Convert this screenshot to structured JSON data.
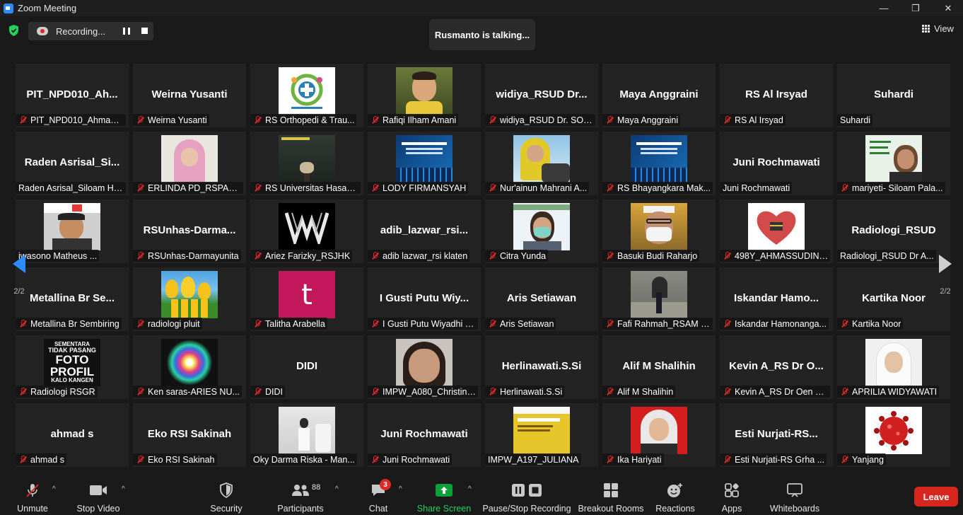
{
  "window": {
    "title": "Zoom Meeting",
    "minimize": "—",
    "restore": "❐",
    "close": "✕"
  },
  "recording": {
    "label": "Recording..."
  },
  "speaker_banner": "Rusmanto is talking...",
  "view_label": "View",
  "pager": {
    "prev": "2/2",
    "next": "2/2"
  },
  "tiles": [
    {
      "big": "PIT_NPD010_Ah...",
      "name": "PIT_NPD010_Ahmad ...",
      "muted": true
    },
    {
      "big": "Weirna Yusanti",
      "name": "Weirna Yusanti",
      "muted": true
    },
    {
      "photo": "ortho-logo",
      "name": "RS Orthopedi & Trau...",
      "muted": true
    },
    {
      "photo": "boy-photo",
      "name": "Rafiqi Ilham Amani",
      "muted": true
    },
    {
      "big": "widiya_RSUD Dr...",
      "name": "widiya_RSUD Dr. SOE...",
      "muted": true
    },
    {
      "big": "Maya Anggraini",
      "name": "Maya Anggraini",
      "muted": true
    },
    {
      "big": "RS Al Irsyad",
      "name": "RS Al Irsyad",
      "muted": true
    },
    {
      "big": "Suhardi",
      "name": "Suhardi",
      "muted": false
    },
    {
      "big": "Raden Asrisal_Si...",
      "name": "Raden Asrisal_Siloam Ho...",
      "muted": false
    },
    {
      "photo": "hijab-girl",
      "name": "ERLINDA PD_RSPAU ...",
      "muted": true
    },
    {
      "photo": "room-plant",
      "name": "RS Universitas Hasan...",
      "muted": true
    },
    {
      "photo": "webinar-blue",
      "name": "LODY FIRMANSYAH",
      "muted": true
    },
    {
      "photo": "hijab-yellow",
      "name": "Nur'ainun Mahrani A...",
      "muted": true
    },
    {
      "photo": "webinar-blue",
      "name": "RS Bhayangkara Mak...",
      "muted": true
    },
    {
      "big": "Juni Rochmawati",
      "name": "Juni Rochmawati",
      "muted": false
    },
    {
      "photo": "woman-slide",
      "name": "mariyeti- Siloam Pala...",
      "muted": true
    },
    {
      "photo": "man-banner",
      "name": "iwasono Matheus ...",
      "muted": false
    },
    {
      "big": "RSUnhas-Darma...",
      "name": "RSUnhas-Darmayunita",
      "muted": true
    },
    {
      "photo": "ww-logo",
      "name": "Ariez Farizky_RSJHK",
      "muted": true
    },
    {
      "big": "adib_lazwar_rsi...",
      "name": "adib lazwar_rsi klaten",
      "muted": true
    },
    {
      "photo": "mask-person",
      "name": "Citra Yunda",
      "muted": true
    },
    {
      "photo": "mask-glasses",
      "name": "Basuki Budi Raharjo",
      "muted": true
    },
    {
      "photo": "heart-hands",
      "name": "498Y_AHMASSUDIN_...",
      "muted": true
    },
    {
      "big": "Radiologi_RSUD",
      "name": "Radiologi_RSUD Dr A...",
      "muted": false
    },
    {
      "big": "Metallina Br Se...",
      "name": "Metallina Br Sembiring",
      "muted": true
    },
    {
      "photo": "tulips",
      "name": "radiologi pluit",
      "muted": true
    },
    {
      "photo": "letter-t",
      "name": "Talitha Arabella",
      "muted": true
    },
    {
      "big": "I Gusti Putu Wiy...",
      "name": "I Gusti Putu Wiyadhi S...",
      "muted": true
    },
    {
      "big": "Aris Setiawan",
      "name": "Aris Setiawan",
      "muted": true
    },
    {
      "photo": "gate-person",
      "name": "Fafi Rahmah_RSAM B...",
      "muted": true
    },
    {
      "big": "Iskandar Hamo...",
      "name": "Iskandar Hamonanga...",
      "muted": true
    },
    {
      "big": "Kartika Noor",
      "name": "Kartika Noor",
      "muted": true
    },
    {
      "photo": "poster",
      "name": "Radiologi RSGR",
      "muted": true,
      "poster": [
        "SEMENTARA",
        "TIDAK PASANG",
        "FOTO",
        "PROFIL",
        "KALO KANGEN"
      ]
    },
    {
      "photo": "orb",
      "name": "Ken saras-ARIES NU...",
      "muted": true
    },
    {
      "big": "DIDI",
      "name": "DIDI",
      "muted": true
    },
    {
      "photo": "woman-face",
      "name": "IMPW_A080_Christin I...",
      "muted": true
    },
    {
      "big": "Herlinawati.S.Si",
      "name": "Herlinawati.S.Si",
      "muted": true
    },
    {
      "big": "Alif M Shalihin",
      "name": "Alif M Shalihin",
      "muted": true
    },
    {
      "big": "Kevin A_RS Dr O...",
      "name": "Kevin A_RS Dr Oen S...",
      "muted": true
    },
    {
      "photo": "hijab-white",
      "name": "APRILIA WIDYAWATI",
      "muted": true
    },
    {
      "big": "ahmad s",
      "name": "ahmad s",
      "muted": true
    },
    {
      "big": "Eko RSI Sakinah",
      "name": "Eko RSI Sakinah",
      "muted": true
    },
    {
      "photo": "lab-person",
      "name": "Oky Darma Riska - Man...",
      "muted": false
    },
    {
      "big": "Juni Rochmawati",
      "name": "Juni Rochmawati",
      "muted": true
    },
    {
      "photo": "webinar-yellow",
      "name": "IMPW_A197_JULIANA",
      "muted": false
    },
    {
      "photo": "hijab-red",
      "name": "Ika Hariyati",
      "muted": true
    },
    {
      "big": "Esti Nurjati-RS...",
      "name": "Esti Nurjati-RS Grha ...",
      "muted": true
    },
    {
      "photo": "virus",
      "name": "Yanjang",
      "muted": true
    }
  ],
  "toolbar": {
    "unmute": "Unmute",
    "stop_video": "Stop Video",
    "security": "Security",
    "participants": "Participants",
    "participants_count": "88",
    "chat": "Chat",
    "chat_badge": "3",
    "share_screen": "Share Screen",
    "recording": "Pause/Stop Recording",
    "breakout": "Breakout Rooms",
    "reactions": "Reactions",
    "apps": "Apps",
    "whiteboards": "Whiteboards",
    "leave": "Leave"
  },
  "colors": {
    "accent_green": "#23d160",
    "share_green": "#0e9f3a",
    "muted_red": "#e02828",
    "leave_red": "#d7261e",
    "nav_blue": "#2d8cff"
  }
}
